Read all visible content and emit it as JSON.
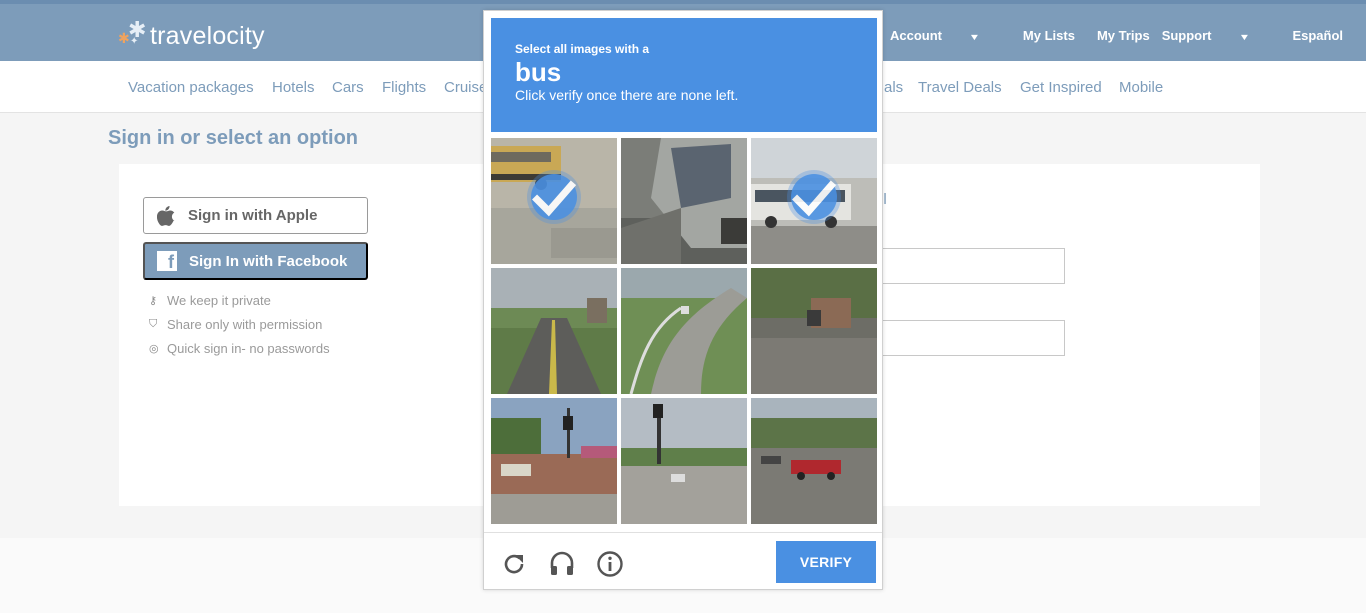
{
  "brand": {
    "name": "travelocity"
  },
  "top_nav": [
    "Account",
    "My Lists",
    "My Trips",
    "Support",
    "Español"
  ],
  "sub_nav": [
    "Vacation packages",
    "Hotels",
    "Cars",
    "Flights",
    "Cruises",
    "als",
    "Travel Deals",
    "Get Inspired",
    "Mobile"
  ],
  "page": {
    "title": "Sign in or select an option"
  },
  "sign_in": {
    "apple_label": "Sign in with Apple",
    "facebook_label": "Sign In with Facebook",
    "perks": [
      "We keep it private",
      "Share only with permission",
      "Quick sign in- no passwords"
    ],
    "right_link_fragment": "il"
  },
  "captcha": {
    "instruction_line1": "Select all images with a",
    "target": "bus",
    "instruction_line2": "Click verify once there are none left.",
    "tiles_selected": [
      true,
      false,
      true,
      false,
      false,
      false,
      false,
      false,
      false
    ],
    "verify_label": "VERIFY",
    "icons": [
      "refresh-icon",
      "audio-icon",
      "info-icon"
    ],
    "accent_color": "#4a90e2"
  },
  "colors": {
    "topbar": "#7d9cba",
    "link": "#7d9cba"
  }
}
